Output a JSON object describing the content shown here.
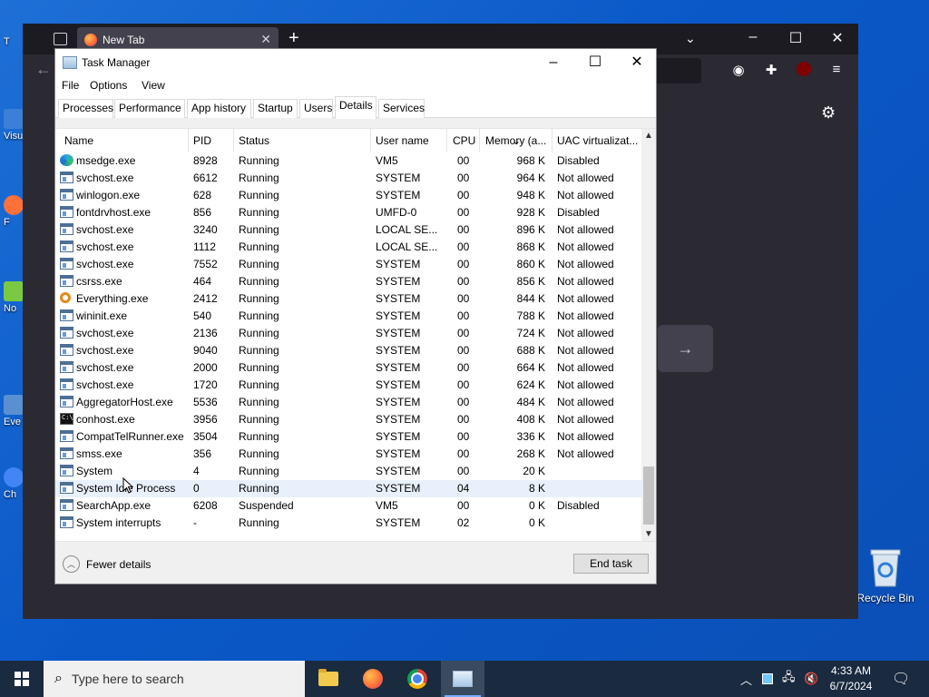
{
  "desktop": {
    "left_icon_labels": [
      "T",
      "Visu",
      "F",
      "No",
      "Eve",
      "Ch"
    ],
    "recycle_bin_label": "Recycle Bin"
  },
  "firefox": {
    "tab_title": "New Tab"
  },
  "task_manager": {
    "title": "Task Manager",
    "menu": [
      "File",
      "Options",
      "View"
    ],
    "tabs": [
      "Processes",
      "Performance",
      "App history",
      "Startup",
      "Users",
      "Details",
      "Services"
    ],
    "active_tab": "Details",
    "columns": [
      "Name",
      "PID",
      "Status",
      "User name",
      "CPU",
      "Memory (a...",
      "UAC virtualizat..."
    ],
    "rows": [
      {
        "icon": "edge",
        "name": "msedge.exe",
        "pid": "8928",
        "status": "Running",
        "user": "VM5",
        "cpu": "00",
        "mem": "968 K",
        "uac": "Disabled"
      },
      {
        "icon": "win",
        "name": "svchost.exe",
        "pid": "6612",
        "status": "Running",
        "user": "SYSTEM",
        "cpu": "00",
        "mem": "964 K",
        "uac": "Not allowed"
      },
      {
        "icon": "win",
        "name": "winlogon.exe",
        "pid": "628",
        "status": "Running",
        "user": "SYSTEM",
        "cpu": "00",
        "mem": "948 K",
        "uac": "Not allowed"
      },
      {
        "icon": "win",
        "name": "fontdrvhost.exe",
        "pid": "856",
        "status": "Running",
        "user": "UMFD-0",
        "cpu": "00",
        "mem": "928 K",
        "uac": "Disabled"
      },
      {
        "icon": "win",
        "name": "svchost.exe",
        "pid": "3240",
        "status": "Running",
        "user": "LOCAL SE...",
        "cpu": "00",
        "mem": "896 K",
        "uac": "Not allowed"
      },
      {
        "icon": "win",
        "name": "svchost.exe",
        "pid": "1112",
        "status": "Running",
        "user": "LOCAL SE...",
        "cpu": "00",
        "mem": "868 K",
        "uac": "Not allowed"
      },
      {
        "icon": "win",
        "name": "svchost.exe",
        "pid": "7552",
        "status": "Running",
        "user": "SYSTEM",
        "cpu": "00",
        "mem": "860 K",
        "uac": "Not allowed"
      },
      {
        "icon": "win",
        "name": "csrss.exe",
        "pid": "464",
        "status": "Running",
        "user": "SYSTEM",
        "cpu": "00",
        "mem": "856 K",
        "uac": "Not allowed"
      },
      {
        "icon": "search",
        "name": "Everything.exe",
        "pid": "2412",
        "status": "Running",
        "user": "SYSTEM",
        "cpu": "00",
        "mem": "844 K",
        "uac": "Not allowed"
      },
      {
        "icon": "win",
        "name": "wininit.exe",
        "pid": "540",
        "status": "Running",
        "user": "SYSTEM",
        "cpu": "00",
        "mem": "788 K",
        "uac": "Not allowed"
      },
      {
        "icon": "win",
        "name": "svchost.exe",
        "pid": "2136",
        "status": "Running",
        "user": "SYSTEM",
        "cpu": "00",
        "mem": "724 K",
        "uac": "Not allowed"
      },
      {
        "icon": "win",
        "name": "svchost.exe",
        "pid": "9040",
        "status": "Running",
        "user": "SYSTEM",
        "cpu": "00",
        "mem": "688 K",
        "uac": "Not allowed"
      },
      {
        "icon": "win",
        "name": "svchost.exe",
        "pid": "2000",
        "status": "Running",
        "user": "SYSTEM",
        "cpu": "00",
        "mem": "664 K",
        "uac": "Not allowed"
      },
      {
        "icon": "win",
        "name": "svchost.exe",
        "pid": "1720",
        "status": "Running",
        "user": "SYSTEM",
        "cpu": "00",
        "mem": "624 K",
        "uac": "Not allowed"
      },
      {
        "icon": "win",
        "name": "AggregatorHost.exe",
        "pid": "5536",
        "status": "Running",
        "user": "SYSTEM",
        "cpu": "00",
        "mem": "484 K",
        "uac": "Not allowed"
      },
      {
        "icon": "console",
        "name": "conhost.exe",
        "pid": "3956",
        "status": "Running",
        "user": "SYSTEM",
        "cpu": "00",
        "mem": "408 K",
        "uac": "Not allowed"
      },
      {
        "icon": "win",
        "name": "CompatTelRunner.exe",
        "pid": "3504",
        "status": "Running",
        "user": "SYSTEM",
        "cpu": "00",
        "mem": "336 K",
        "uac": "Not allowed"
      },
      {
        "icon": "win",
        "name": "smss.exe",
        "pid": "356",
        "status": "Running",
        "user": "SYSTEM",
        "cpu": "00",
        "mem": "268 K",
        "uac": "Not allowed"
      },
      {
        "icon": "win",
        "name": "System",
        "pid": "4",
        "status": "Running",
        "user": "SYSTEM",
        "cpu": "00",
        "mem": "20 K",
        "uac": ""
      },
      {
        "icon": "win",
        "name": "System Idle Process",
        "pid": "0",
        "status": "Running",
        "user": "SYSTEM",
        "cpu": "04",
        "mem": "8 K",
        "uac": "",
        "selected": true
      },
      {
        "icon": "win",
        "name": "SearchApp.exe",
        "pid": "6208",
        "status": "Suspended",
        "user": "VM5",
        "cpu": "00",
        "mem": "0 K",
        "uac": "Disabled"
      },
      {
        "icon": "win",
        "name": "System interrupts",
        "pid": "-",
        "status": "Running",
        "user": "SYSTEM",
        "cpu": "02",
        "mem": "0 K",
        "uac": ""
      }
    ],
    "fewer_details_label": "Fewer details",
    "end_task_label": "End task"
  },
  "taskbar": {
    "search_placeholder": "Type here to search",
    "clock_time": "4:33 AM",
    "clock_date": "6/7/2024"
  },
  "colors": {
    "desktop_blue": "#0a58c8",
    "firefox_bg": "#2b2a33",
    "taskbar_bg": "#1a2a3f",
    "selected_row": "#e8f1fb"
  }
}
